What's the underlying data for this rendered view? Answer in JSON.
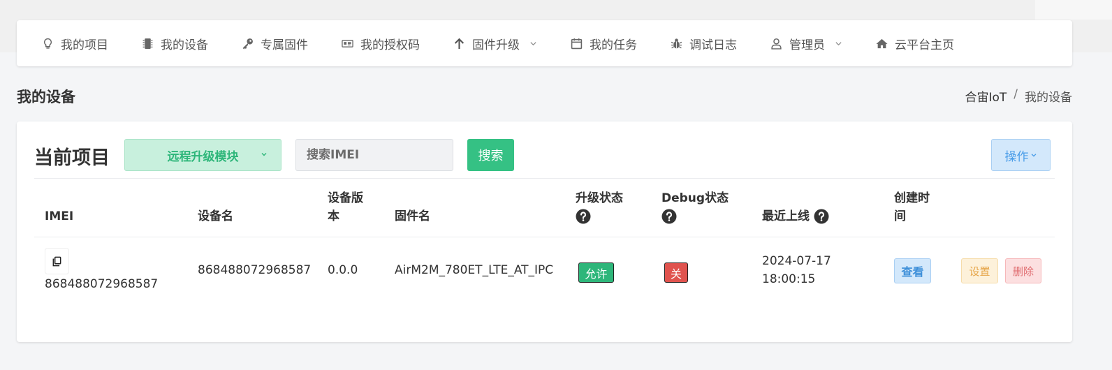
{
  "nav": {
    "items": [
      {
        "label": "我的项目",
        "icon": "lightbulb-icon"
      },
      {
        "label": "我的设备",
        "icon": "chip-icon"
      },
      {
        "label": "专属固件",
        "icon": "key-icon"
      },
      {
        "label": "我的授权码",
        "icon": "id-card-icon"
      },
      {
        "label": "固件升级",
        "icon": "arrow-up-icon",
        "dropdown": true
      },
      {
        "label": "我的任务",
        "icon": "calendar-icon"
      },
      {
        "label": "调试日志",
        "icon": "bug-icon"
      },
      {
        "label": "管理员",
        "icon": "user-icon",
        "dropdown": true
      },
      {
        "label": "云平台主页",
        "icon": "home-icon"
      }
    ]
  },
  "page": {
    "title": "我的设备",
    "breadcrumb": {
      "root": "合宙IoT",
      "sep": "/",
      "current": "我的设备"
    }
  },
  "toolbar": {
    "title": "当前项目",
    "project_selected": "远程升级模块",
    "search_placeholder": "搜索IMEI",
    "search_label": "搜索",
    "ops_label": "操作"
  },
  "table": {
    "headers": {
      "imei": "IMEI",
      "name": "设备名",
      "version_line1": "设备版",
      "version_line2": "本",
      "firmware": "固件名",
      "upgrade": "升级状态",
      "debug": "Debug状态",
      "last_online": "最近上线",
      "created_line1": "创建时",
      "created_line2": "间"
    },
    "rows": [
      {
        "imei": "868488072968587",
        "name": "868488072968587",
        "version": "0.0.0",
        "firmware": "AirM2M_780ET_LTE_AT_IPC",
        "upgrade": "允许",
        "debug": "关",
        "last_online_date": "2024-07-17",
        "last_online_time": "18:00:15",
        "view": "查看",
        "settings": "设置",
        "delete": "删除"
      }
    ]
  },
  "colors": {
    "accent_green": "#35c184",
    "danger_red": "#e0534e",
    "info_blue": "#4a9de8"
  }
}
